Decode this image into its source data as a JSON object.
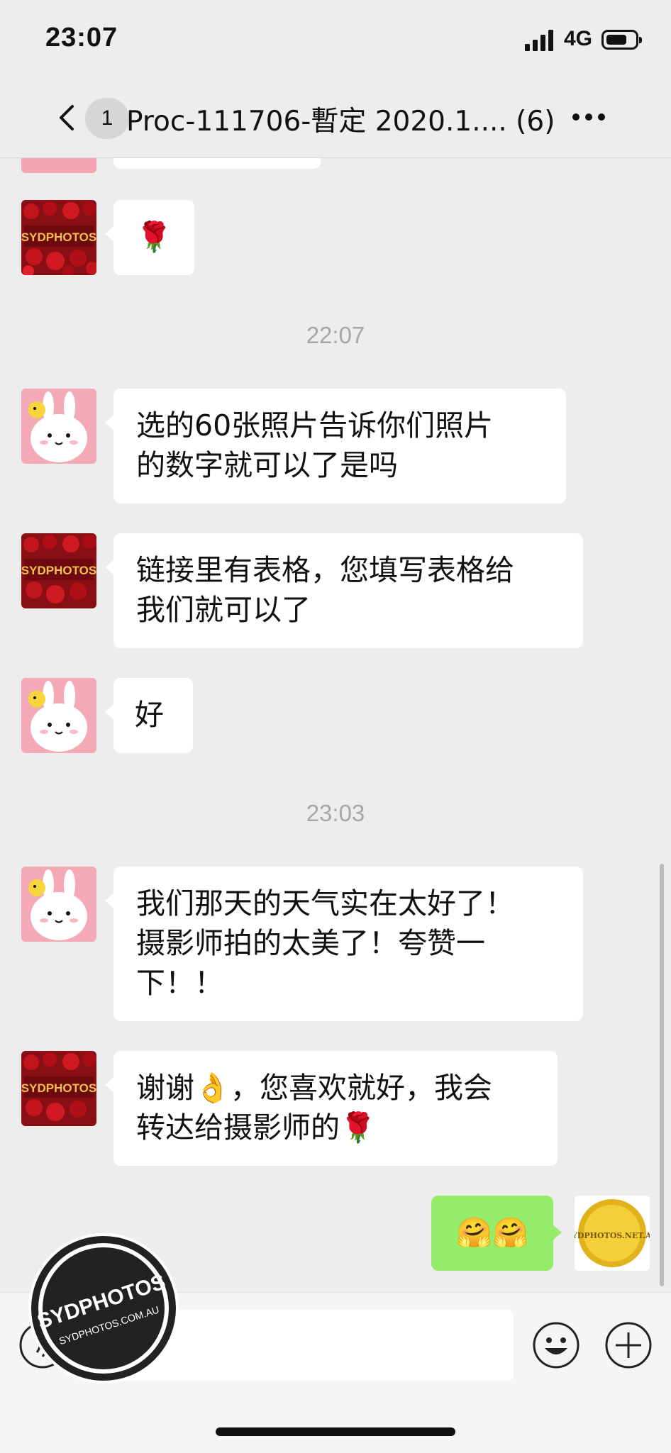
{
  "status_bar": {
    "time": "23:07",
    "network": "4G",
    "battery_level": 0.6
  },
  "nav": {
    "unread_count": "1",
    "title": "Proc-111706-暫定 2020.1.... (6)"
  },
  "messages": {
    "m2": {
      "text": "🌹"
    },
    "ts1": "22:07",
    "m3": {
      "line1": "选的60张照片告诉你们照片",
      "line2": "的数字就可以了是吗"
    },
    "m4": {
      "line1": "链接里有表格，您填写表格给",
      "line2": "我们就可以了"
    },
    "m5": {
      "text": "好"
    },
    "ts2": "23:03",
    "m6": {
      "line1": "我们那天的天气实在太好了！",
      "line2": "摄影师拍的太美了！夸赞一",
      "line3": "下！！"
    },
    "m7": {
      "line1": "谢谢👌，您喜欢就好，我会",
      "line2": "转达给摄影师的🌹"
    },
    "m8": {
      "text": "🤗🤗"
    }
  },
  "avatars": {
    "shop_logo_text": "SYDPHOTOS",
    "self_badge_text": "SYDPHOTOS.NET.AU"
  },
  "watermark": {
    "brand": "SYDPHOTOS",
    "url": "SYDPHOTOS.COM.AU"
  },
  "icons": [
    "back-icon",
    "more-icon",
    "voice-icon",
    "emoji-icon",
    "plus-icon"
  ]
}
